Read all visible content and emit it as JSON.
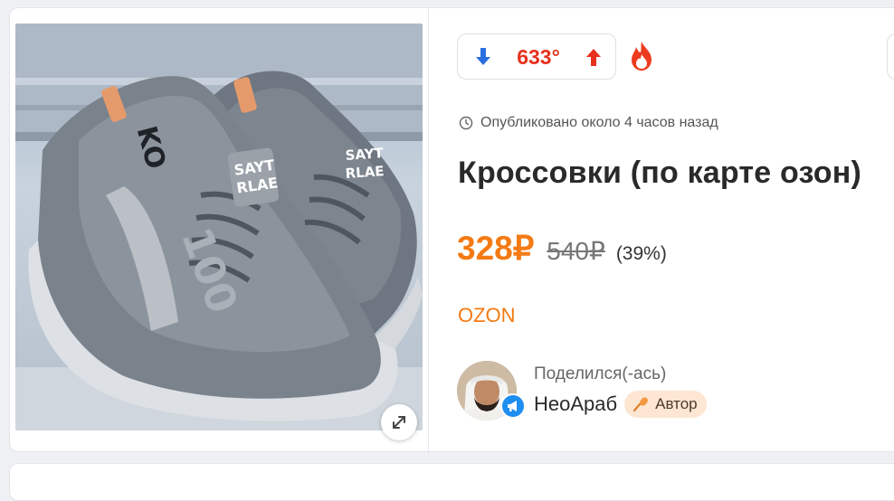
{
  "deal": {
    "vote": {
      "score": "633°",
      "down_icon": "arrow-down-icon",
      "up_icon": "arrow-up-icon",
      "hot_icon": "flame-icon",
      "colors": {
        "score": "#e6311d",
        "down": "#2a6fe0",
        "up": "#e6311d"
      }
    },
    "posted": {
      "icon": "clock-icon",
      "text": "Опубликовано около 4 часов назад"
    },
    "title": "Кроссовки (по карте озон)",
    "price": {
      "current": "328₽",
      "original": "540₽",
      "discount": "(39%)",
      "color": "#f47a13"
    },
    "store": "OZON",
    "author": {
      "shared_label": "Поделился(-ась)",
      "name": "НеоАраб",
      "badge_label": "Автор",
      "badge_icon": "microphone-icon",
      "avatar_badge_icon": "megaphone-icon"
    },
    "image": {
      "expand_icon": "expand-icon",
      "shoe_text": [
        "SAYT",
        "RLAE",
        "100",
        "KO"
      ]
    }
  }
}
